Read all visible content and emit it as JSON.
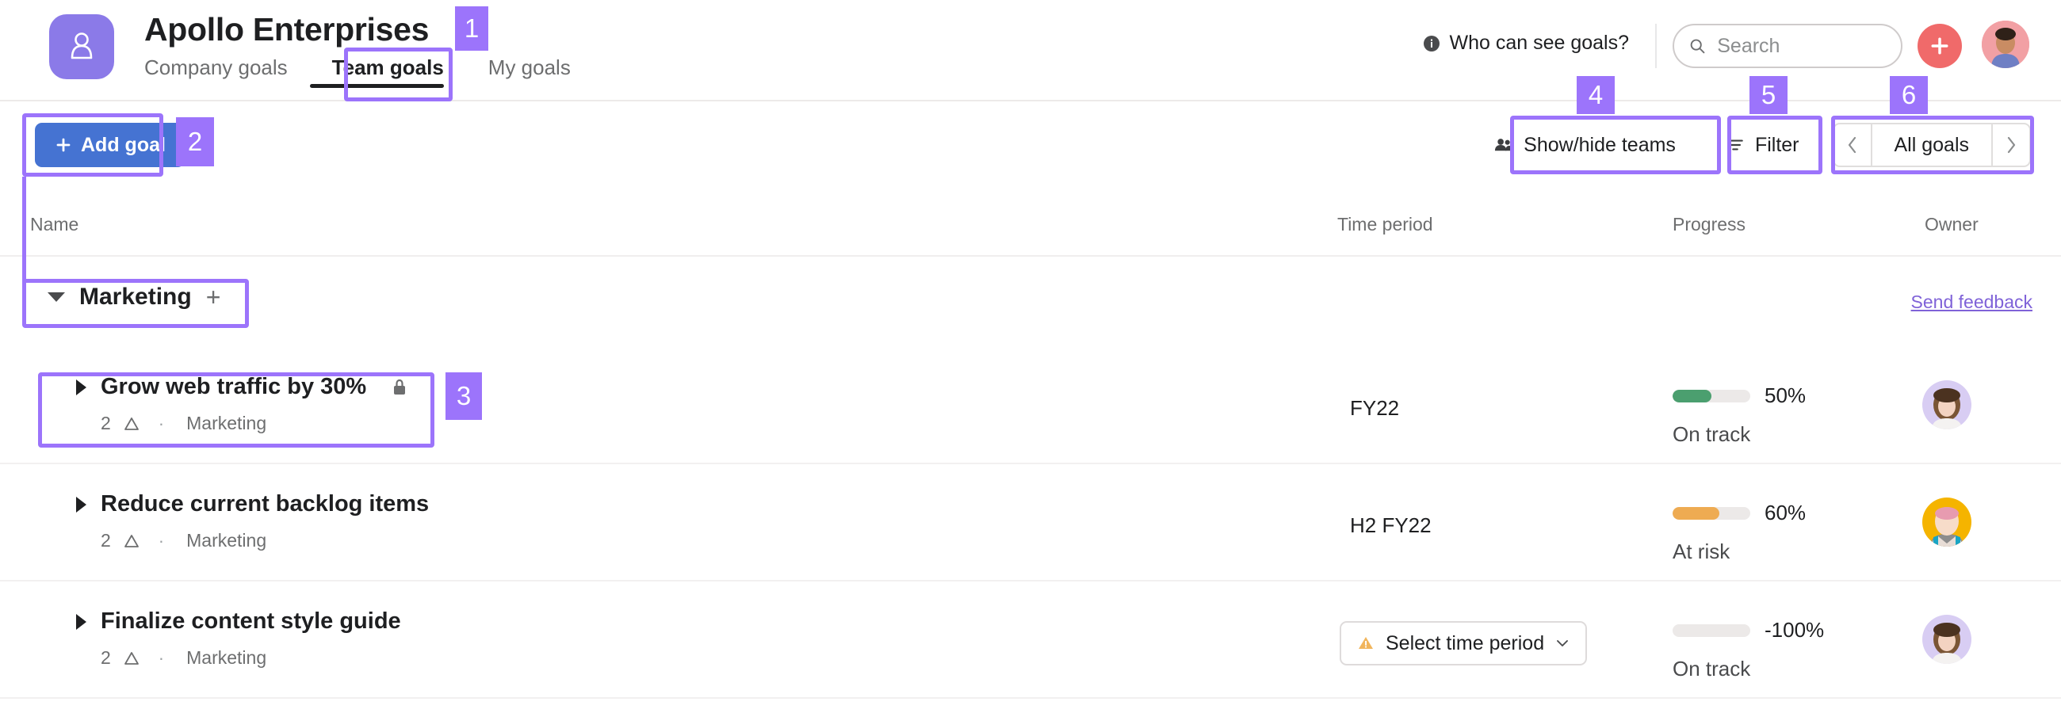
{
  "header": {
    "logo_icon": "person-badge-icon",
    "title": "Apollo Enterprises",
    "tabs": [
      {
        "label": "Company goals",
        "active": false
      },
      {
        "label": "Team goals",
        "active": true
      },
      {
        "label": "My goals",
        "active": false
      }
    ],
    "who_can_see": "Who can see goals?",
    "info_icon": "info-icon",
    "search": {
      "placeholder": "Search",
      "value": "",
      "icon": "search-icon"
    },
    "create_button_icon": "plus-icon",
    "avatar": "user-avatar"
  },
  "toolbar": {
    "add_goal_label": "Add goal",
    "add_goal_icon": "plus-icon",
    "show_hide_teams_label": "Show/hide teams",
    "show_hide_teams_icon": "people-icon",
    "filter_label": "Filter",
    "filter_icon": "filter-icon",
    "pager": {
      "prev_icon": "chevron-left-icon",
      "label": "All goals",
      "next_icon": "chevron-right-icon"
    }
  },
  "table": {
    "columns": [
      "Name",
      "Time period",
      "Progress",
      "Owner"
    ],
    "send_feedback": "Send feedback",
    "section": {
      "name": "Marketing",
      "collapse_icon": "caret-down-icon",
      "add_icon": "plus-icon",
      "expanded": true
    },
    "rows": [
      {
        "expand_icon": "caret-right-icon",
        "title": "Grow web traffic by 30%",
        "private_icon": "lock-icon",
        "is_private": true,
        "subgoal_count": "2",
        "subgoal_icon": "goal-triangle-icon",
        "separator": "·",
        "team": "Marketing",
        "time_period": "FY22",
        "time_period_is_select": false,
        "progress_pct": "50%",
        "progress_value": 50,
        "progress_color": "#4b9f6f",
        "status": "On track",
        "owner_avatar": "owner-avatar-purple"
      },
      {
        "expand_icon": "caret-right-icon",
        "title": "Reduce current backlog items",
        "private_icon": "",
        "is_private": false,
        "subgoal_count": "2",
        "subgoal_icon": "goal-triangle-icon",
        "separator": "·",
        "team": "Marketing",
        "time_period": "H2 FY22",
        "time_period_is_select": false,
        "progress_pct": "60%",
        "progress_value": 60,
        "progress_color": "#eeab52",
        "status": "At risk",
        "owner_avatar": "owner-avatar-orange"
      },
      {
        "expand_icon": "caret-right-icon",
        "title": "Finalize content style guide",
        "private_icon": "",
        "is_private": false,
        "subgoal_count": "2",
        "subgoal_icon": "goal-triangle-icon",
        "separator": "·",
        "team": "Marketing",
        "time_period": "Select time period",
        "time_period_is_select": true,
        "time_period_warn_icon": "warning-triangle-icon",
        "time_period_chevron_icon": "chevron-down-icon",
        "progress_pct": "-100%",
        "progress_value": 0,
        "progress_color": "#ece9e8",
        "status": "On track",
        "owner_avatar": "owner-avatar-purple"
      }
    ]
  },
  "annotations": {
    "color": "#9c74fb",
    "badges": [
      {
        "n": "1"
      },
      {
        "n": "2"
      },
      {
        "n": "3"
      },
      {
        "n": "4"
      },
      {
        "n": "5"
      },
      {
        "n": "6"
      }
    ]
  },
  "colors": {
    "accent_purple": "#9c74fb",
    "brand_logo": "#8b7ae8",
    "primary_button": "#4573d2",
    "create_fab": "#f06a6a",
    "on_track_green": "#4b9f6f",
    "at_risk_orange": "#eeab52",
    "link_purple": "#7f62d8",
    "text_primary": "#1e1f21",
    "text_secondary": "#6d6e6f"
  }
}
